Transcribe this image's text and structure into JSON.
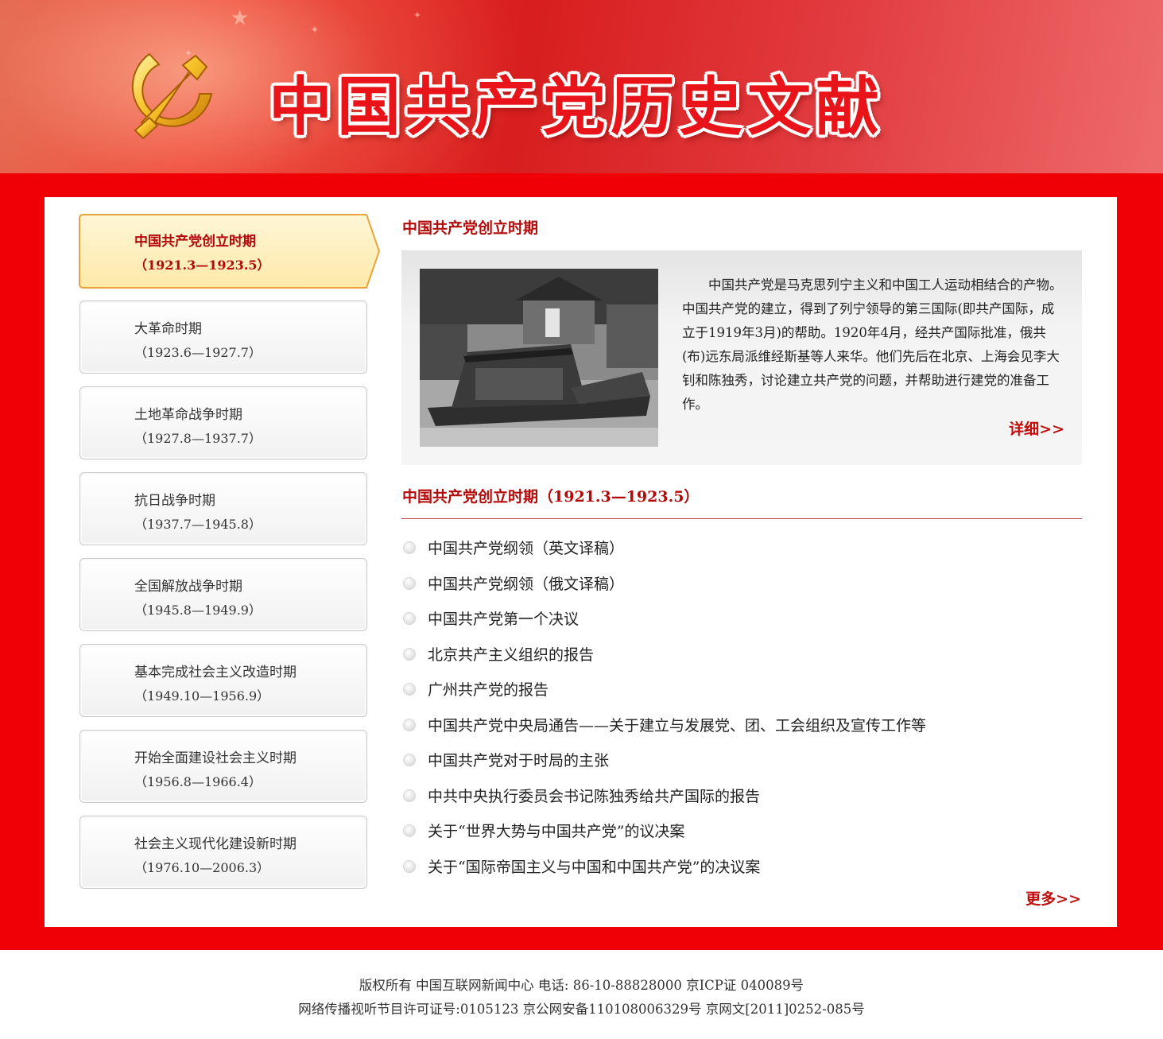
{
  "banner": {
    "title": "中国共产党历史文献"
  },
  "nav": {
    "active": {
      "name": "中国共产党创立时期",
      "range": "（1921.3—1923.5）"
    },
    "items": [
      {
        "name": "大革命时期",
        "range": "（1923.6—1927.7）"
      },
      {
        "name": "土地革命战争时期",
        "range": "（1927.8—1937.7）"
      },
      {
        "name": "抗日战争时期",
        "range": "（1937.7—1945.8）"
      },
      {
        "name": "全国解放战争时期",
        "range": "（1945.8—1949.9）"
      },
      {
        "name": "基本完成社会主义改造时期",
        "range": "（1949.10—1956.9）"
      },
      {
        "name": "开始全面建设社会主义时期",
        "range": "（1956.8—1966.4）"
      },
      {
        "name": "社会主义现代化建设新时期",
        "range": "（1976.10—2006.3）"
      }
    ]
  },
  "intro": {
    "title": "中国共产党创立时期",
    "text": "中国共产党是马克思列宁主义和中国工人运动相结合的产物。中国共产党的建立，得到了列宁领导的第三国际(即共产国际，成立于1919年3月)的帮助。1920年4月，经共产国际批准，俄共(布)远东局派维经斯基等人来华。他们先后在北京、上海会见李大钊和陈独秀，讨论建立共产党的问题，并帮助进行建党的准备工作。",
    "detail_label": "详细>>"
  },
  "documents": {
    "title": "中国共产党创立时期（1921.3—1923.5）",
    "items": [
      "中国共产党纲领（英文译稿）",
      "中国共产党纲领（俄文译稿）",
      "中国共产党第一个决议",
      "北京共产主义组织的报告",
      "广州共产党的报告",
      "中国共产党中央局通告——关于建立与发展党、团、工会组织及宣传工作等",
      "中国共产党对于时局的主张",
      "中共中央执行委员会书记陈独秀给共产国际的报告",
      "关于“世界大势与中国共产党”的议决案",
      "关于“国际帝国主义与中国和中国共产党”的决议案"
    ],
    "more_label": "更多>>"
  },
  "footer": {
    "line1": "版权所有 中国互联网新闻中心 电话: 86-10-88828000 京ICP证 040089号",
    "line2": "网络传播视听节目许可证号:0105123 京公网安备110108006329号 京网文[2011]0252-085号"
  },
  "colors": {
    "brand_red": "#f00006",
    "title_red": "#b30a0a",
    "link_red": "#c20d0d"
  }
}
